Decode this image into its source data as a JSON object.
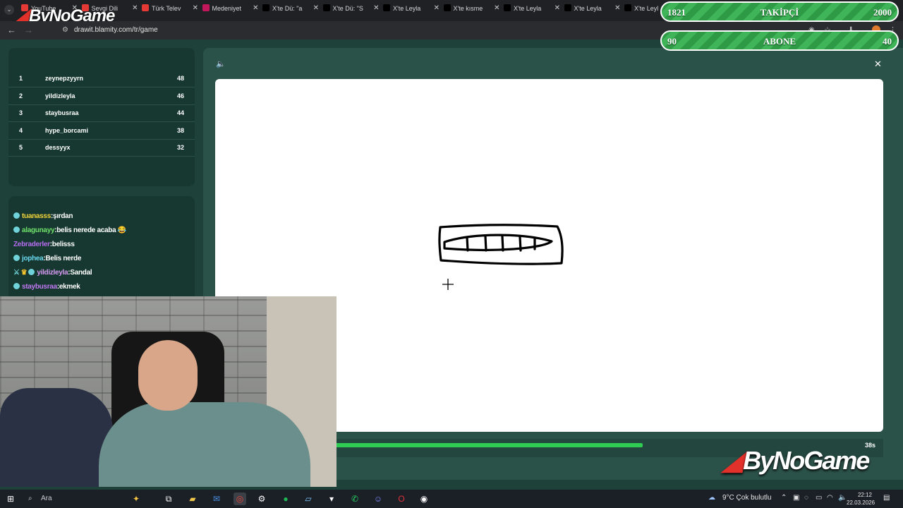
{
  "browser": {
    "tabs": [
      {
        "label": "YouTube",
        "color": "#e53935"
      },
      {
        "label": "Sevgi Dili",
        "color": "#e53935"
      },
      {
        "label": "Türk Telev",
        "color": "#e53935"
      },
      {
        "label": "Medeniyet",
        "color": "#c2185b"
      },
      {
        "label": "X'te Dü: \"a",
        "color": "#000000"
      },
      {
        "label": "X'te Dü: \"S",
        "color": "#000000"
      },
      {
        "label": "X'te Leyla",
        "color": "#000000"
      },
      {
        "label": "X'te kısme",
        "color": "#000000"
      },
      {
        "label": "X'te Leyla",
        "color": "#000000"
      },
      {
        "label": "X'te Leyla",
        "color": "#000000"
      },
      {
        "label": "X'te Leyl",
        "color": "#000000"
      }
    ],
    "url": "drawit.blamity.com/tr/game"
  },
  "brand": {
    "name": "ByNoGame"
  },
  "overlay": {
    "followers": {
      "current": "1821",
      "label": "TAKİPÇİ",
      "goal": "2000"
    },
    "subs": {
      "current": "90",
      "label": "ABONE",
      "goal": "40"
    }
  },
  "leaderboard": [
    {
      "rank": "1",
      "name": "zeynepzyyrn",
      "score": "48"
    },
    {
      "rank": "2",
      "name": "yildizleyla",
      "score": "46"
    },
    {
      "rank": "3",
      "name": "staybusraa",
      "score": "44"
    },
    {
      "rank": "4",
      "name": "hype_borcami",
      "score": "38"
    },
    {
      "rank": "5",
      "name": "dessyyx",
      "score": "32"
    }
  ],
  "chat": [
    {
      "user": "tuanasss",
      "text": ":şırdan",
      "user_color": "#f2d43a",
      "badge": "verified-icon"
    },
    {
      "user": "alagunayy",
      "text": ":belis nerede acaba 😂",
      "user_color": "#6ee06a",
      "badge": "verified-icon"
    },
    {
      "user": "Zebraderler",
      "text": ":belisss",
      "user_color": "#b46cf0",
      "badge": ""
    },
    {
      "user": "jophea",
      "text": ":Belis nerde",
      "user_color": "#6ad8ee",
      "badge": "verified-icon"
    },
    {
      "user": "yildizleyla",
      "text": ":Sandal",
      "user_color": "#d79af3",
      "badge": "sword-crown-verified"
    },
    {
      "user": "staybusraa",
      "text": ":ekmek",
      "user_color": "#c078f3",
      "badge": "verified-icon"
    }
  ],
  "game": {
    "timer_label": "38s",
    "timer_progress": 0.64
  },
  "taskbar": {
    "search_placeholder": "Ara",
    "weather": "9°C  Çok bulutlu",
    "time": "22:12",
    "date": "22.03.2026"
  }
}
